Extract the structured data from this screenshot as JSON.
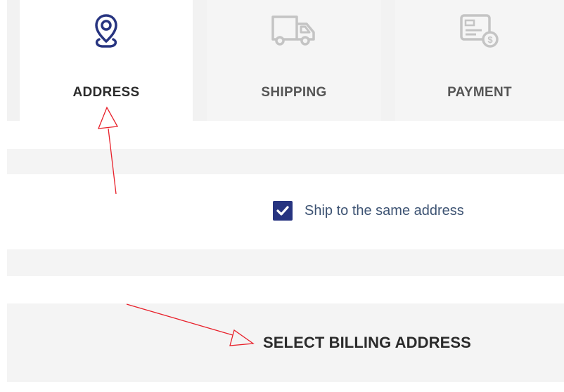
{
  "steps": [
    {
      "label": "ADDRESS",
      "icon": "map-pin-icon",
      "state": "active"
    },
    {
      "label": "SHIPPING",
      "icon": "delivery-truck-icon",
      "state": "inactive"
    },
    {
      "label": "PAYMENT",
      "icon": "payment-card-dollar-icon",
      "state": "inactive"
    }
  ],
  "ship_same_address": {
    "label": "Ship to the same address",
    "checked": true
  },
  "billing": {
    "title": "SELECT BILLING ADDRESS"
  },
  "colors": {
    "accent": "#273480",
    "annotation": "#e8202a",
    "inactive_icon": "#c4c4c4",
    "band": "#f4f4f4"
  }
}
